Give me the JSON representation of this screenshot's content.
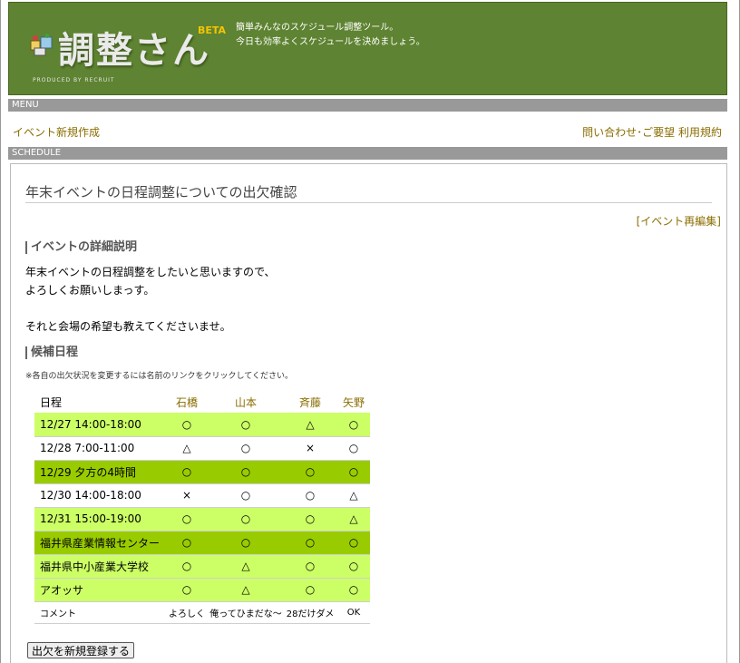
{
  "header": {
    "logo_text": "調整さん",
    "logo_beta": "BETA",
    "logo_produced": "PRODUCED BY RECRUIT",
    "tagline_line1": "簡単みんなのスケジュール調整ツール。",
    "tagline_line2": "今日も効率よくスケジュールを決めましょう。",
    "bg_color": "#5e8332"
  },
  "menu": {
    "bar_label": "MENU",
    "new_event": "イベント新規作成",
    "contact": "問い合わせ･ご要望",
    "terms": "利用規約"
  },
  "schedule": {
    "bar_label": "SCHEDULE",
    "event_title": "年末イベントの日程調整についての出欠確認",
    "edit_link": "[イベント再編集]",
    "desc_heading": "イベントの詳細説明",
    "description": "年末イベントの日程調整をしたいと思いますので、\nよろしくお願いしまっす。\n\nそれと会場の希望も教えてくださいませ。",
    "candidates_heading": "候補日程",
    "note": "※各自の出欠状況を変更するには名前のリンクをクリックしてください。",
    "table": {
      "date_header": "日程",
      "participants": [
        "石橋",
        "山本",
        "斉藤",
        "矢野"
      ],
      "rows": [
        {
          "date": "12/27 14:00-18:00",
          "marks": [
            "○",
            "○",
            "△",
            "○"
          ],
          "style": "light"
        },
        {
          "date": "12/28 7:00-11:00",
          "marks": [
            "△",
            "○",
            "×",
            "○"
          ],
          "style": "white"
        },
        {
          "date": "12/29 夕方の4時間",
          "marks": [
            "○",
            "○",
            "○",
            "○"
          ],
          "style": "dark"
        },
        {
          "date": "12/30 14:00-18:00",
          "marks": [
            "×",
            "○",
            "○",
            "△"
          ],
          "style": "white"
        },
        {
          "date": "12/31 15:00-19:00",
          "marks": [
            "○",
            "○",
            "○",
            "△"
          ],
          "style": "light"
        },
        {
          "date": "福井県産業情報センター",
          "marks": [
            "○",
            "○",
            "○",
            "○"
          ],
          "style": "dark"
        },
        {
          "date": "福井県中小産業大学校",
          "marks": [
            "○",
            "△",
            "○",
            "○"
          ],
          "style": "light"
        },
        {
          "date": "アオッサ",
          "marks": [
            "○",
            "△",
            "○",
            "○"
          ],
          "style": "light"
        }
      ],
      "comment_label": "コメント",
      "comments": [
        "よろしく",
        "俺ってひまだな〜",
        "28だけダメ",
        "OK"
      ]
    },
    "register_button": "出欠を新規登録する"
  },
  "colors": {
    "row_light": "#ccff66",
    "row_dark": "#99cc00",
    "link": "#8a6d00",
    "section_bar": "#999999"
  }
}
